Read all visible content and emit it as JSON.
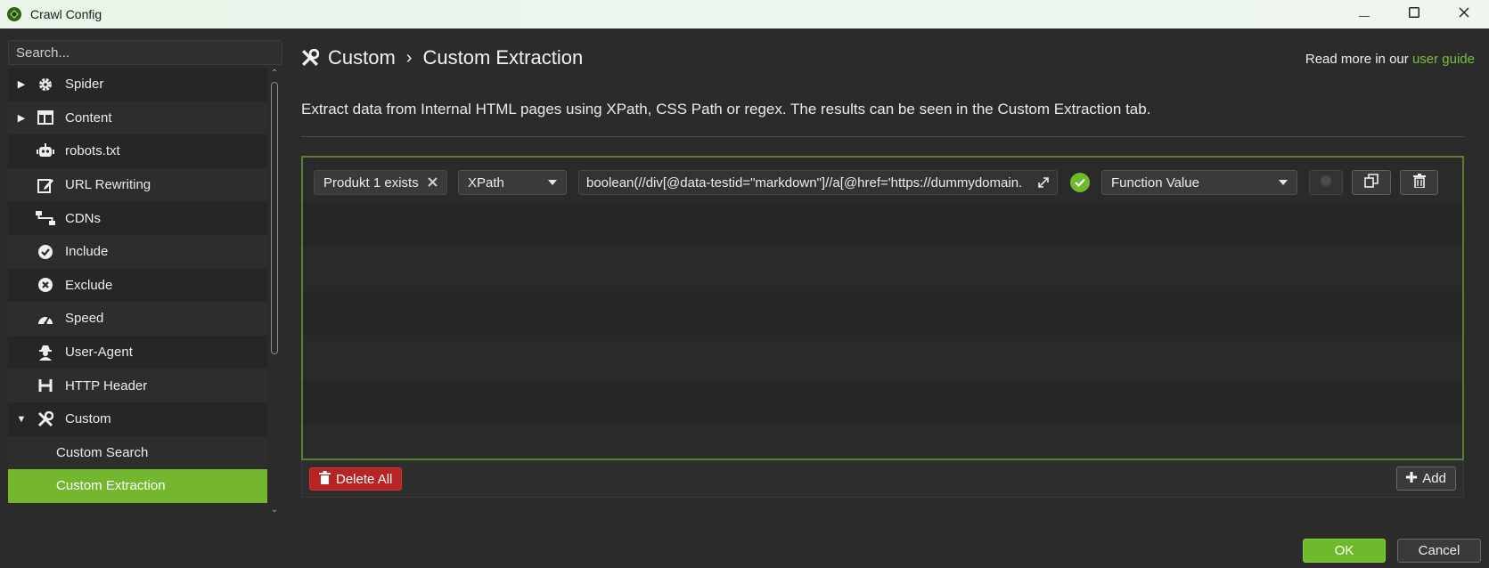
{
  "window": {
    "title": "Crawl Config",
    "icons": {
      "app": "spider-logo-icon",
      "minimize": "minimize-icon",
      "maximize": "maximize-icon",
      "close": "close-icon"
    }
  },
  "sidebar": {
    "search_placeholder": "Search...",
    "items": [
      {
        "label": "Spider",
        "icon": "gear-icon",
        "expandable": true
      },
      {
        "label": "Content",
        "icon": "layout-icon",
        "expandable": true
      },
      {
        "label": "robots.txt",
        "icon": "robot-icon"
      },
      {
        "label": "URL Rewriting",
        "icon": "edit-icon"
      },
      {
        "label": "CDNs",
        "icon": "network-icon"
      },
      {
        "label": "Include",
        "icon": "check-circle-icon"
      },
      {
        "label": "Exclude",
        "icon": "x-circle-icon"
      },
      {
        "label": "Speed",
        "icon": "speedometer-icon"
      },
      {
        "label": "User-Agent",
        "icon": "user-secret-icon"
      },
      {
        "label": "HTTP Header",
        "icon": "heading-icon"
      },
      {
        "label": "Custom",
        "icon": "tools-icon",
        "expanded": true
      },
      {
        "label": "Custom Search",
        "child": true
      },
      {
        "label": "Custom Extraction",
        "child": true,
        "selected": true
      }
    ]
  },
  "header": {
    "section": "Custom",
    "separator": "›",
    "page": "Custom Extraction",
    "read_more_prefix": "Read more in our",
    "read_more_link": "user guide",
    "icon": "tools-icon"
  },
  "description": "Extract data from Internal HTML pages using XPath, CSS Path or regex. The results can be seen in the Custom Extraction tab.",
  "extractors": [
    {
      "name": "Produkt 1 exists",
      "type": "XPath",
      "expression": "boolean(//div[@data-testid=\"markdown\"]//a[@href='https://dummydomain.",
      "valid": true,
      "output": "Function Value"
    }
  ],
  "footer": {
    "delete_all_label": "Delete All",
    "add_label": "Add"
  },
  "dialog": {
    "ok_label": "OK",
    "cancel_label": "Cancel"
  },
  "colors": {
    "accent": "#74b72e",
    "danger": "#b82323",
    "background": "#2b2b2b",
    "link": "#7cbf3a"
  }
}
